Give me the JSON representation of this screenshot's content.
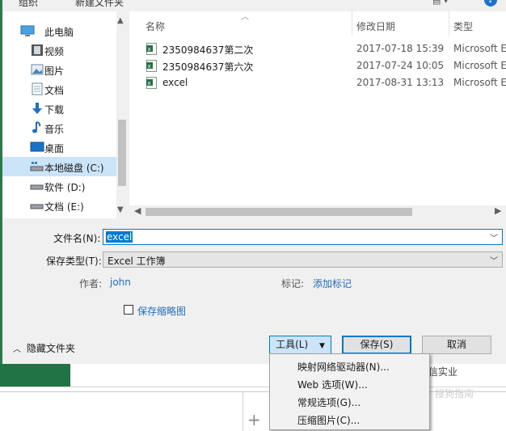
{
  "toolbar": {
    "organize": "组织",
    "new_folder": "新建文件夹",
    "view_glyph": "▤ ▾",
    "help": "?"
  },
  "nav": {
    "items": [
      {
        "label": "此电脑",
        "icon": "computer-icon"
      },
      {
        "label": "视频",
        "icon": "video-folder-icon"
      },
      {
        "label": "图片",
        "icon": "pictures-folder-icon"
      },
      {
        "label": "文档",
        "icon": "documents-folder-icon"
      },
      {
        "label": "下载",
        "icon": "download-arrow-icon"
      },
      {
        "label": "音乐",
        "icon": "music-note-icon"
      },
      {
        "label": "桌面",
        "icon": "desktop-icon"
      },
      {
        "label": "本地磁盘 (C:)",
        "icon": "drive-icon",
        "selected": true
      },
      {
        "label": "软件 (D:)",
        "icon": "drive-icon"
      },
      {
        "label": "文档 (E:)",
        "icon": "drive-icon"
      }
    ]
  },
  "columns": {
    "name": "名称",
    "modified": "修改日期",
    "type": "类型"
  },
  "files": [
    {
      "name": "2350984637第二次",
      "modified": "2017-07-18 15:39",
      "type": "Microsoft E"
    },
    {
      "name": "2350984637第六次",
      "modified": "2017-07-24 10:05",
      "type": "Microsoft E"
    },
    {
      "name": "excel",
      "modified": "2017-08-31 13:13",
      "type": "Microsoft E"
    }
  ],
  "form": {
    "filename_label": "文件名(N):",
    "filename_value": "excel",
    "filetype_label": "保存类型(T):",
    "filetype_value": "Excel 工作簿",
    "author_label": "作者:",
    "author_value": "john",
    "tags_label": "标记:",
    "tags_value": "添加标记",
    "thumbnail_label": "保存缩略图"
  },
  "footer": {
    "hide_folders": "隐藏文件夹",
    "tools": "工具(L)",
    "save": "保存(S)",
    "cancel": "取消"
  },
  "tools_menu": [
    "映射网络驱动器(N)...",
    "Web 选项(W)...",
    "常规选项(G)...",
    "压缩图片(C)..."
  ],
  "background": {
    "right_text": "信实业",
    "watermark": "搜狗指南"
  },
  "colors": {
    "accent": "#0078d7",
    "excel_green": "#217346",
    "selection": "#cce4f7",
    "link": "#1e6bbf"
  }
}
